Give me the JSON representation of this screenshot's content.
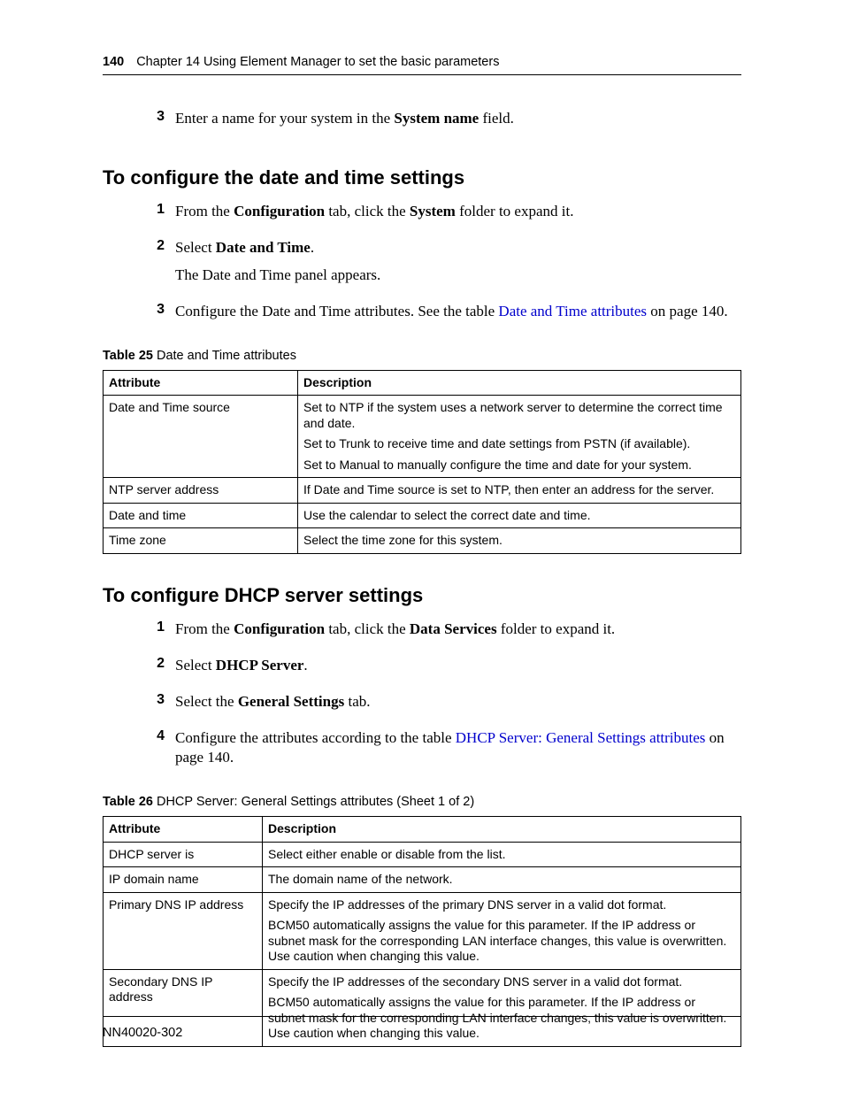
{
  "header": {
    "page_number": "140",
    "chapter_line": "Chapter 14  Using Element Manager to set the basic parameters"
  },
  "intro_step": {
    "num": "3",
    "text_before": "Enter a name for your system in the ",
    "bold1": "System name",
    "text_after": " field."
  },
  "section1": {
    "title": "To configure the date and time settings",
    "steps": {
      "s1": {
        "num": "1",
        "p1a": "From the ",
        "p1b": "Configuration",
        "p1c": " tab, click the ",
        "p1d": "System",
        "p1e": " folder to expand it."
      },
      "s2": {
        "num": "2",
        "p1a": "Select ",
        "p1b": "Date and Time",
        "p1c": ".",
        "p2": "The Date and Time panel appears."
      },
      "s3": {
        "num": "3",
        "p1a": "Configure the Date and Time attributes. See the table ",
        "link": "Date and Time attributes",
        "p1b": " on page 140."
      }
    }
  },
  "table25": {
    "caption_bold": "Table 25",
    "caption_rest": "   Date and Time attributes",
    "h1": "Attribute",
    "h2": "Description",
    "rows": {
      "r1": {
        "attr": "Date and Time source",
        "d1": "Set to NTP if the system uses a network server to determine the correct time and date.",
        "d2": "Set to Trunk to receive time and date settings from PSTN (if available).",
        "d3": "Set to Manual to manually configure the time and date for your system."
      },
      "r2": {
        "attr": "NTP server address",
        "d1": "If Date and Time source is set to NTP, then enter an address for the server."
      },
      "r3": {
        "attr": "Date and time",
        "d1": "Use the calendar to select the correct date and time."
      },
      "r4": {
        "attr": "Time zone",
        "d1": "Select the time zone for this system."
      }
    }
  },
  "section2": {
    "title": "To configure DHCP server settings",
    "steps": {
      "s1": {
        "num": "1",
        "p1a": "From the ",
        "p1b": "Configuration",
        "p1c": " tab, click the ",
        "p1d": "Data Services",
        "p1e": " folder to expand it."
      },
      "s2": {
        "num": "2",
        "p1a": "Select ",
        "p1b": "DHCP Server",
        "p1c": "."
      },
      "s3": {
        "num": "3",
        "p1a": "Select the ",
        "p1b": "General Settings",
        "p1c": " tab."
      },
      "s4": {
        "num": "4",
        "p1a": "Configure the attributes according to the table ",
        "link": "DHCP Server: General Settings attributes",
        "p1b": " on page 140."
      }
    }
  },
  "table26": {
    "caption_bold": "Table 26",
    "caption_rest": "   DHCP Server: General Settings attributes (Sheet 1 of 2)",
    "h1": "Attribute",
    "h2": "Description",
    "rows": {
      "r1": {
        "attr": "DHCP server is",
        "d1": "Select either enable or disable from the list."
      },
      "r2": {
        "attr": "IP domain name",
        "d1": "The domain name of the network."
      },
      "r3": {
        "attr": "Primary DNS IP address",
        "d1": "Specify the IP addresses of the primary DNS server in a valid dot format.",
        "d2": "BCM50 automatically assigns the value for this parameter. If the IP address or subnet mask for the corresponding LAN interface changes, this value is overwritten. Use caution when changing this value."
      },
      "r4": {
        "attr": "Secondary DNS IP address",
        "d1": "Specify the IP addresses of the secondary DNS server in a valid dot format.",
        "d2": "BCM50 automatically assigns the value for this parameter. If the IP address or subnet mask for the corresponding LAN interface changes, this value is overwritten. Use caution when changing this value."
      }
    }
  },
  "footer": {
    "doc_id": "NN40020-302"
  }
}
